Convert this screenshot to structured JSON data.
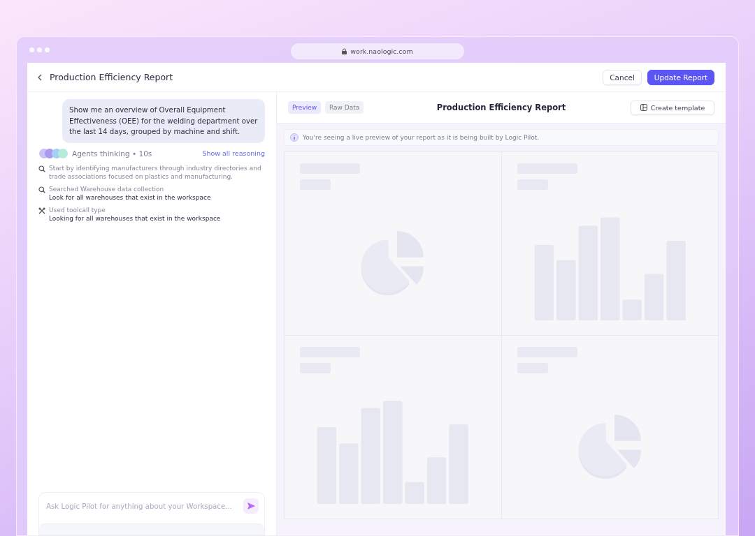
{
  "browser": {
    "url": "work.naologic.com"
  },
  "header": {
    "title": "Production Efficiency Report",
    "buttons": [
      {
        "label": "Cancel",
        "kind": "secondary"
      },
      {
        "label": "Update Report",
        "kind": "primary"
      }
    ]
  },
  "chat": {
    "message": "Show me an overview of Overall Equipment Effectiveness (OEE) for the welding department over the last 14 days, grouped by machine and shift.",
    "status": "Agents thinking",
    "separator": "•",
    "duration": "10s",
    "show_all": "Show all reasoning",
    "steps": [
      {
        "kind": "search",
        "title": "Start by identifying manufacturers through industry directories and trade associations focused on plastics and manufacturing."
      },
      {
        "kind": "search",
        "title": "Searched Warehouse data collection",
        "detail": "Look for all warehouses that exist in the workspace"
      },
      {
        "kind": "toolcall",
        "title": "Used toolcall type",
        "detail": "Looking for all warehouses that exist in the workspace"
      }
    ],
    "input": {
      "placeholder": "Ask Logic Pilot for anything about your Workspace..."
    }
  },
  "preview": {
    "tabs": [
      {
        "label": "Preview",
        "selected": true
      },
      {
        "label": "Raw Data",
        "selected": false
      }
    ],
    "title": "Production Efficiency Report",
    "create_template": "Create template",
    "notice": "You're seeing a live preview of your report as it is being built by Logic Pilot.",
    "cards": [
      {
        "kind": "pie"
      },
      {
        "kind": "bar"
      },
      {
        "kind": "bar"
      },
      {
        "kind": "pie"
      }
    ]
  }
}
